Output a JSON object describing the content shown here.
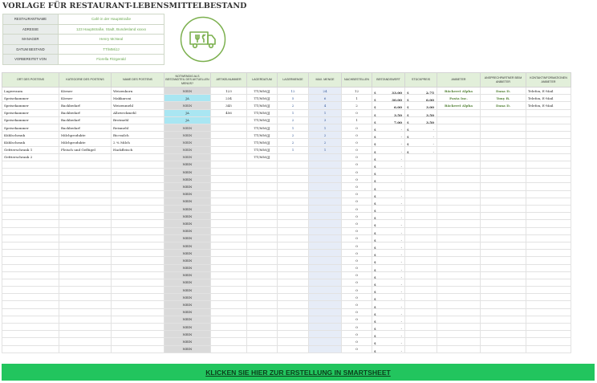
{
  "title": "VORLAGE FÜR RESTAURANT-LEBENSMITTELBESTAND",
  "info": [
    {
      "label": "RESTAURANTNAME",
      "value": "Café in der Hauptstraße"
    },
    {
      "label": "ADRESSE",
      "value": "123 Hauptstraße, Stadt, Bundesland xxxxx"
    },
    {
      "label": "MANAGER",
      "value": "Henry McNeal"
    },
    {
      "label": "DATUM BESTAND",
      "value": "TT/MM/JJ"
    },
    {
      "label": "VORBEREITET VON",
      "value": "Fiorella Fitzgerald"
    }
  ],
  "logo_icon": "food-truck-icon",
  "colors": {
    "header_bg": "#e2efda",
    "accent_green": "#6aa84f",
    "ja_bg": "#a9e6f2",
    "nein_bg": "#dadada",
    "lagermenge_bg": "#e6ecf7",
    "banner_bg": "#22c55e"
  },
  "columns": [
    "ORT DES POSTENS",
    "KATEGORIE DES POSTENS",
    "NAME DES POSTENS",
    "NOTWENDIG ALS BESTANDTEIL DES AKTUELLEN MENÜS?",
    "ARTIKELNUMMER",
    "LAGERDATUM",
    "LAGERMENGE",
    "MAX. MENGE",
    "NACHBESTELLEN",
    "BESTANDSWERT",
    "STÜCKPREIS",
    "ANBIETER",
    "ANSPRECHPARTNER BEIM ANBIETER",
    "KONTAKTINFORMATIONEN ANBIETER"
  ],
  "rows": [
    {
      "ort": "Lagerraum",
      "kat": "Körner",
      "name": "Weizenkorn",
      "notw": "NEIN",
      "art": "123",
      "datum": "TT/MM/JJ",
      "menge": "12",
      "max": "24",
      "nach": "12",
      "wert": "33.00",
      "preis": "2.75",
      "anb": "Bäckerei Alpha",
      "ansp": "Dana D.",
      "kontakt": "Telefon, E-Mail"
    },
    {
      "ort": "Speisekammer",
      "kat": "Körner",
      "name": "Makkaroni",
      "notw": "JA",
      "art": "234",
      "datum": "TT/MM/JJ",
      "menge": "5",
      "max": "6",
      "nach": "1",
      "wert": "30.00",
      "preis": "6.00",
      "anb": "Pasta Inc.",
      "ansp": "Tony B.",
      "kontakt": "Telefon, E-Mail"
    },
    {
      "ort": "Speisekammer",
      "kat": "Backbedarf",
      "name": "Weizenmehl",
      "notw": "NEIN",
      "art": "345",
      "datum": "TT/MM/JJ",
      "menge": "2",
      "max": "4",
      "nach": "2",
      "wert": "6.00",
      "preis": "3.00",
      "anb": "Bäckerei Alpha",
      "ansp": "Dana D.",
      "kontakt": "Telefon, E-Mail"
    },
    {
      "ort": "Speisekammer",
      "kat": "Backbedarf",
      "name": "Allzweckmehl",
      "notw": "JA",
      "art": "456",
      "datum": "TT/MM/JJ",
      "menge": "1",
      "max": "1",
      "nach": "0",
      "wert": "3.50",
      "preis": "3.50",
      "anb": "",
      "ansp": "",
      "kontakt": ""
    },
    {
      "ort": "Speisekammer",
      "kat": "Backbedarf",
      "name": "Brotmehl",
      "notw": "JA",
      "art": "",
      "datum": "TT/MM/JJ",
      "menge": "2",
      "max": "3",
      "nach": "1",
      "wert": "7.00",
      "preis": "3.50",
      "anb": "",
      "ansp": "",
      "kontakt": ""
    },
    {
      "ort": "Speisekammer",
      "kat": "Backbedarf",
      "name": "Reismehl",
      "notw": "NEIN",
      "art": "",
      "datum": "TT/MM/JJ",
      "menge": "1",
      "max": "1",
      "nach": "0",
      "wert": "-",
      "preis": "-",
      "anb": "",
      "ansp": "",
      "kontakt": ""
    },
    {
      "ort": "Kühlschrank",
      "kat": "Milchprodukte",
      "name": "Bio-milch",
      "notw": "NEIN",
      "art": "",
      "datum": "TT/MM/JJ",
      "menge": "2",
      "max": "2",
      "nach": "0",
      "wert": "-",
      "preis": "-",
      "anb": "",
      "ansp": "",
      "kontakt": ""
    },
    {
      "ort": "Kühlschrank",
      "kat": "Milchprodukte",
      "name": "2 % Milch",
      "notw": "NEIN",
      "art": "",
      "datum": "TT/MM/JJ",
      "menge": "2",
      "max": "2",
      "nach": "0",
      "wert": "-",
      "preis": "-",
      "anb": "",
      "ansp": "",
      "kontakt": ""
    },
    {
      "ort": "Gefrierschrank 1",
      "kat": "Fleisch und Geflügel",
      "name": "Hackfleisch",
      "notw": "NEIN",
      "art": "",
      "datum": "TT/MM/JJ",
      "menge": "1",
      "max": "1",
      "nach": "0",
      "wert": "-",
      "preis": "-",
      "anb": "",
      "ansp": "",
      "kontakt": ""
    },
    {
      "ort": "Gefrierschrank 2",
      "kat": "",
      "name": "",
      "notw": "NEIN",
      "art": "",
      "datum": "TT/MM/JJ",
      "menge": "",
      "max": "",
      "nach": "0",
      "wert": "-",
      "preis": "",
      "anb": "",
      "ansp": "",
      "kontakt": ""
    }
  ],
  "empty_row": {
    "notw": "NEIN",
    "nach": "0",
    "wert": "-"
  },
  "empty_row_count": 26,
  "currency": "$",
  "banner": "KLICKEN SIE HIER ZUR ERSTELLUNG IN SMARTSHEET"
}
